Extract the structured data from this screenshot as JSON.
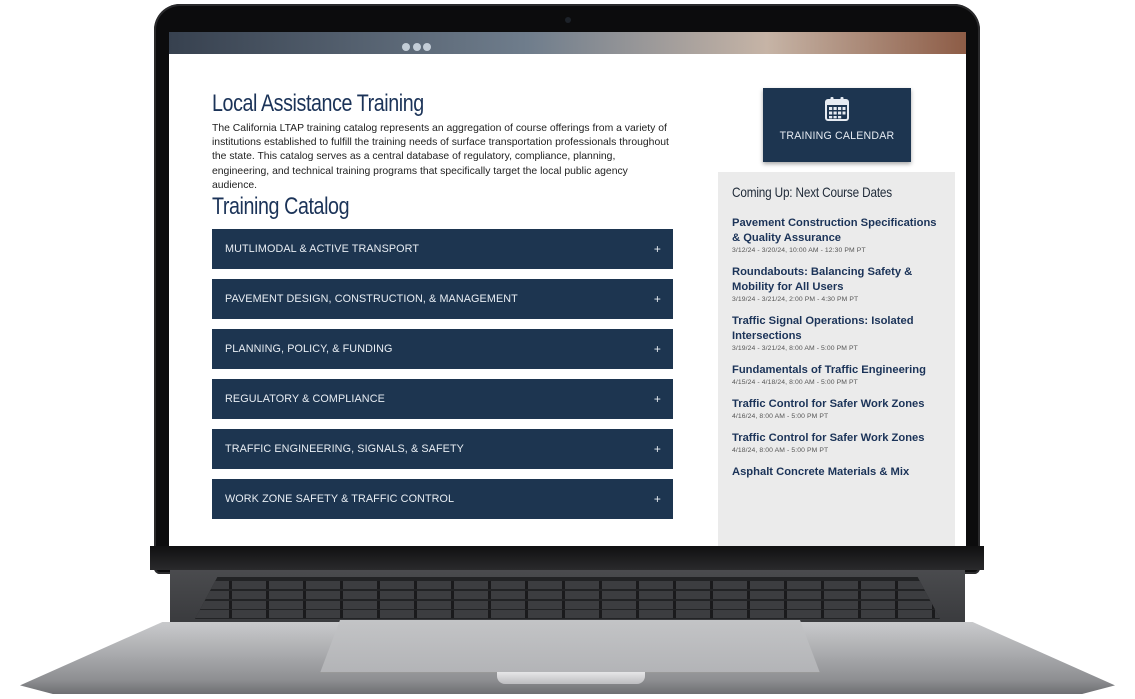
{
  "page": {
    "title": "Local Assistance Training",
    "intro": "The California LTAP training catalog represents an aggregation of course offerings from a variety of institutions established to fulfill the training needs of surface transportation professionals throughout the state. This catalog serves as a central database of regulatory, compliance, planning, engineering, and technical training programs that specifically target the local public agency audience.",
    "catalog_title": "Training Catalog"
  },
  "catalog": {
    "items": [
      {
        "label": "MUTLIMODAL & ACTIVE TRANSPORT",
        "toggle": "+"
      },
      {
        "label": "PAVEMENT DESIGN, CONSTRUCTION, & MANAGEMENT",
        "toggle": "+"
      },
      {
        "label": "PLANNING, POLICY, & FUNDING",
        "toggle": "+"
      },
      {
        "label": "REGULATORY & COMPLIANCE",
        "toggle": "+"
      },
      {
        "label": "TRAFFIC ENGINEERING, SIGNALS, & SAFETY",
        "toggle": "+"
      },
      {
        "label": "WORK ZONE SAFETY & TRAFFIC CONTROL",
        "toggle": "+"
      }
    ]
  },
  "calendar_button": {
    "label": "TRAINING CALENDAR",
    "icon": "calendar-icon"
  },
  "upcoming": {
    "heading": "Coming Up: Next Course Dates",
    "courses": [
      {
        "name": "Pavement Construction Specifications & Quality Assurance",
        "date": "3/12/24 - 3/20/24, 10:00 AM - 12:30 PM PT"
      },
      {
        "name": "Roundabouts: Balancing Safety & Mobility for All Users",
        "date": "3/19/24 - 3/21/24, 2:00 PM - 4:30 PM PT"
      },
      {
        "name": "Traffic Signal Operations: Isolated Intersections",
        "date": "3/19/24 - 3/21/24, 8:00 AM - 5:00 PM PT"
      },
      {
        "name": "Fundamentals of Traffic Engineering",
        "date": "4/15/24 - 4/18/24, 8:00 AM - 5:00 PM PT"
      },
      {
        "name": "Traffic Control for Safer Work Zones",
        "date": "4/16/24, 8:00 AM - 5:00 PM PT"
      },
      {
        "name": "Traffic Control for Safer Work Zones",
        "date": "4/18/24, 8:00 AM - 5:00 PM PT"
      },
      {
        "name": "Asphalt Concrete Materials & Mix",
        "date": ""
      }
    ]
  },
  "colors": {
    "navy": "#1d3550",
    "heading_blue": "#1b3358",
    "sidebar_bg": "#ebebeb"
  }
}
